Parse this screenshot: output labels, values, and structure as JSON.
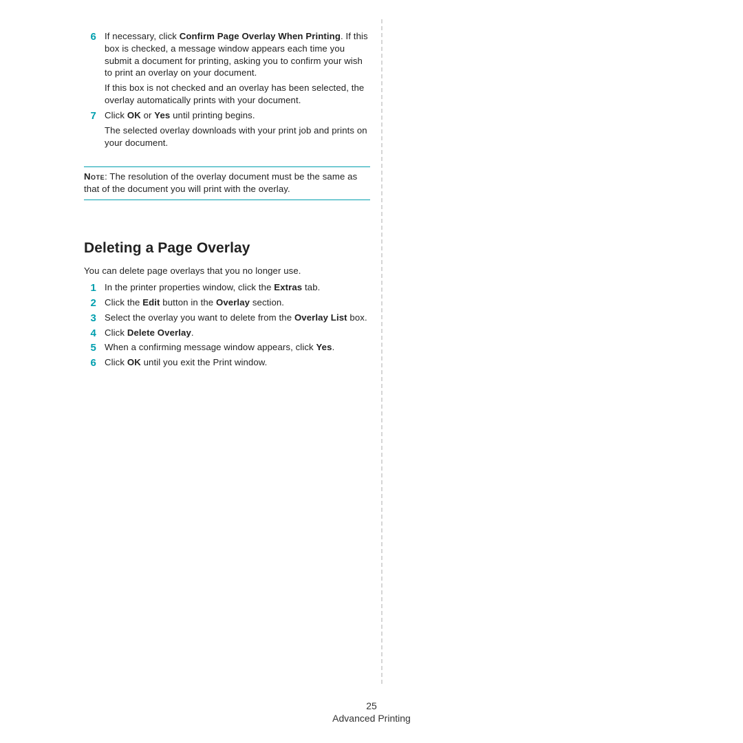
{
  "colors": {
    "accent": "#009fae"
  },
  "sectionA": {
    "step6": {
      "num": "6",
      "t1a": "If necessary, click ",
      "t1b": "Confirm Page Overlay When Printing",
      "t1c": ". If this box is checked, a message window appears each time you submit a document for printing, asking you to confirm your wish to print an overlay on your document.",
      "t2": "If this box is not checked and an overlay has been selected, the overlay automatically prints with your document."
    },
    "step7": {
      "num": "7",
      "t1a": "Click ",
      "t1b": "OK",
      "t1c": " or ",
      "t1d": "Yes",
      "t1e": " until printing begins.",
      "t2": "The selected overlay downloads with your print job and prints on your document."
    }
  },
  "note": {
    "label": "Note",
    "text": ": The resolution of the overlay document must be the same as that of the document you will print with the overlay."
  },
  "sectionB": {
    "heading": "Deleting a Page Overlay",
    "intro": "You can delete page overlays that you no longer use.",
    "steps": {
      "n1": "1",
      "s1a": "In the printer properties window, click the ",
      "s1b": "Extras",
      "s1c": " tab.",
      "n2": "2",
      "s2a": "Click the ",
      "s2b": "Edit",
      "s2c": " button in the ",
      "s2d": "Overlay",
      "s2e": " section.",
      "n3": "3",
      "s3a": "Select the overlay you want to delete from the ",
      "s3b": "Overlay List",
      "s3c": " box.",
      "n4": "4",
      "s4a": "Click ",
      "s4b": "Delete Overlay",
      "s4c": ".",
      "n5": "5",
      "s5a": "When a confirming message window appears, click ",
      "s5b": "Yes",
      "s5c": ".",
      "n6": "6",
      "s6a": "Click ",
      "s6b": "OK",
      "s6c": " until you exit the Print window."
    }
  },
  "footer": {
    "page": "25",
    "title": "Advanced Printing"
  }
}
